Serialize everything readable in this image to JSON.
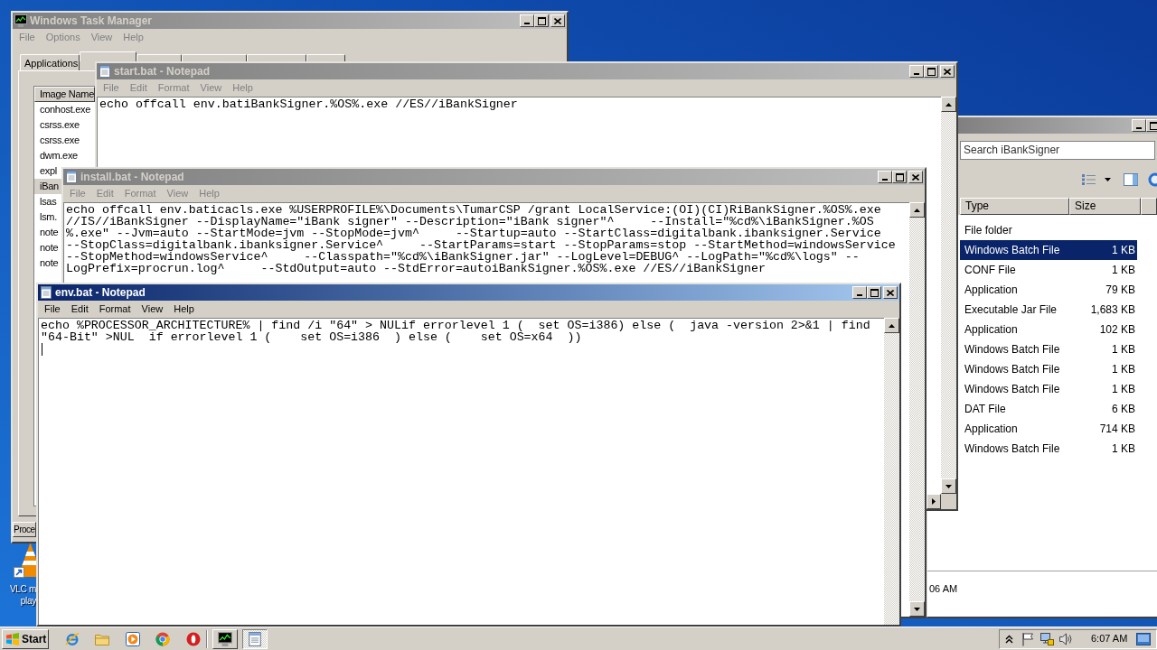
{
  "task_manager": {
    "title": "Windows Task Manager",
    "active": false,
    "menu": [
      "File",
      "Options",
      "View",
      "Help"
    ],
    "tabs": [
      {
        "label": "Applications",
        "selected": false
      },
      {
        "selected": true
      },
      {
        "selected": false
      },
      {
        "selected": false
      },
      {
        "selected": false
      },
      {
        "selected": false
      }
    ],
    "process_list": {
      "columns": [
        "Image Name"
      ],
      "rows": [
        {
          "name": "conhost.exe",
          "selected": false
        },
        {
          "name": "csrss.exe",
          "selected": false
        },
        {
          "name": "csrss.exe",
          "selected": false
        },
        {
          "name": "dwm.exe",
          "selected": false
        },
        {
          "name": "expl",
          "selected": false
        },
        {
          "name": "iBan",
          "selected": true
        },
        {
          "name": "lsas",
          "selected": false
        },
        {
          "name": "lsm.",
          "selected": false
        },
        {
          "name": "note",
          "selected": false
        },
        {
          "name": "note",
          "selected": false
        },
        {
          "name": "note",
          "selected": false
        }
      ]
    },
    "buttons": [
      "Proce"
    ]
  },
  "notepad_windows": [
    {
      "title": "start.bat - Notepad",
      "active": false,
      "menu": [
        "File",
        "Edit",
        "Format",
        "View",
        "Help"
      ],
      "lines": [
        "echo offcall env.batiBankSigner.%OS%.exe //ES//iBankSigner"
      ]
    },
    {
      "title": "install.bat - Notepad",
      "active": false,
      "menu": [
        "File",
        "Edit",
        "Format",
        "View",
        "Help"
      ],
      "lines": [
        "echo offcall env.baticacls.exe %USERPROFILE%\\Documents\\TumarCSP /grant LocalService:(OI)(CI)RiBankSigner.%OS%.exe",
        "//IS//iBankSigner --DisplayName=\"iBank signer\" --Description=\"iBank signer\"^     --Install=\"%cd%\\iBankSigner.%OS",
        "%.exe\" --Jvm=auto --StartMode=jvm --StopMode=jvm^     --Startup=auto --StartClass=digitalbank.ibanksigner.Service",
        "--StopClass=digitalbank.ibanksigner.Service^     --StartParams=start --StopParams=stop --StartMethod=windowsService",
        "--StopMethod=windowsService^     --Classpath=\"%cd%\\iBankSigner.jar\" --LogLevel=DEBUG^ --LogPath=\"%cd%\\logs\" --",
        "LogPrefix=procrun.log^     --StdOutput=auto --StdError=autoiBankSigner.%OS%.exe //ES//iBankSigner"
      ]
    },
    {
      "title": "env.bat - Notepad",
      "active": true,
      "menu": [
        "File",
        "Edit",
        "Format",
        "View",
        "Help"
      ],
      "lines": [
        "echo %PROCESSOR_ARCHITECTURE% | find /i \"64\" > NULif errorlevel 1 (  set OS=i386) else (  java -version 2>&1 | find",
        "\"64-Bit\" >NUL  if errorlevel 1 (    set OS=i386  ) else (    set OS=x64  ))"
      ]
    }
  ],
  "explorer": {
    "active": false,
    "search": {
      "placeholder": "Search iBankSigner"
    },
    "columns": [
      "Type",
      "Size"
    ],
    "rows": [
      {
        "type": "File folder",
        "selected": false
      },
      {
        "type": "Windows Batch File",
        "size": "1 KB",
        "selected": true
      },
      {
        "type": "CONF File",
        "size": "1 KB",
        "selected": false
      },
      {
        "type": "Application",
        "size": "79 KB",
        "selected": false
      },
      {
        "type": "Executable Jar File",
        "size": "1,683 KB",
        "selected": false
      },
      {
        "type": "Application",
        "size": "102 KB",
        "selected": false
      },
      {
        "type": "Windows Batch File",
        "size": "1 KB",
        "selected": false
      },
      {
        "type": "Windows Batch File",
        "size": "1 KB",
        "selected": false
      },
      {
        "type": "Windows Batch File",
        "size": "1 KB",
        "selected": false
      },
      {
        "type": "DAT File",
        "size": "6 KB",
        "selected": false
      },
      {
        "type": "Application",
        "size": "714 KB",
        "selected": false
      },
      {
        "type": "Windows Batch File",
        "size": "1 KB",
        "selected": false
      }
    ],
    "details": "06 AM"
  },
  "desktop": {
    "shortcuts": [
      {
        "label_lines": [
          "VLC m",
          "play"
        ]
      }
    ]
  },
  "taskbar": {
    "start_label": "Start",
    "tasks": [
      {
        "kind": "task_manager",
        "selected": false
      },
      {
        "kind": "notepad",
        "selected": true
      }
    ],
    "clock": "6:07 AM"
  }
}
